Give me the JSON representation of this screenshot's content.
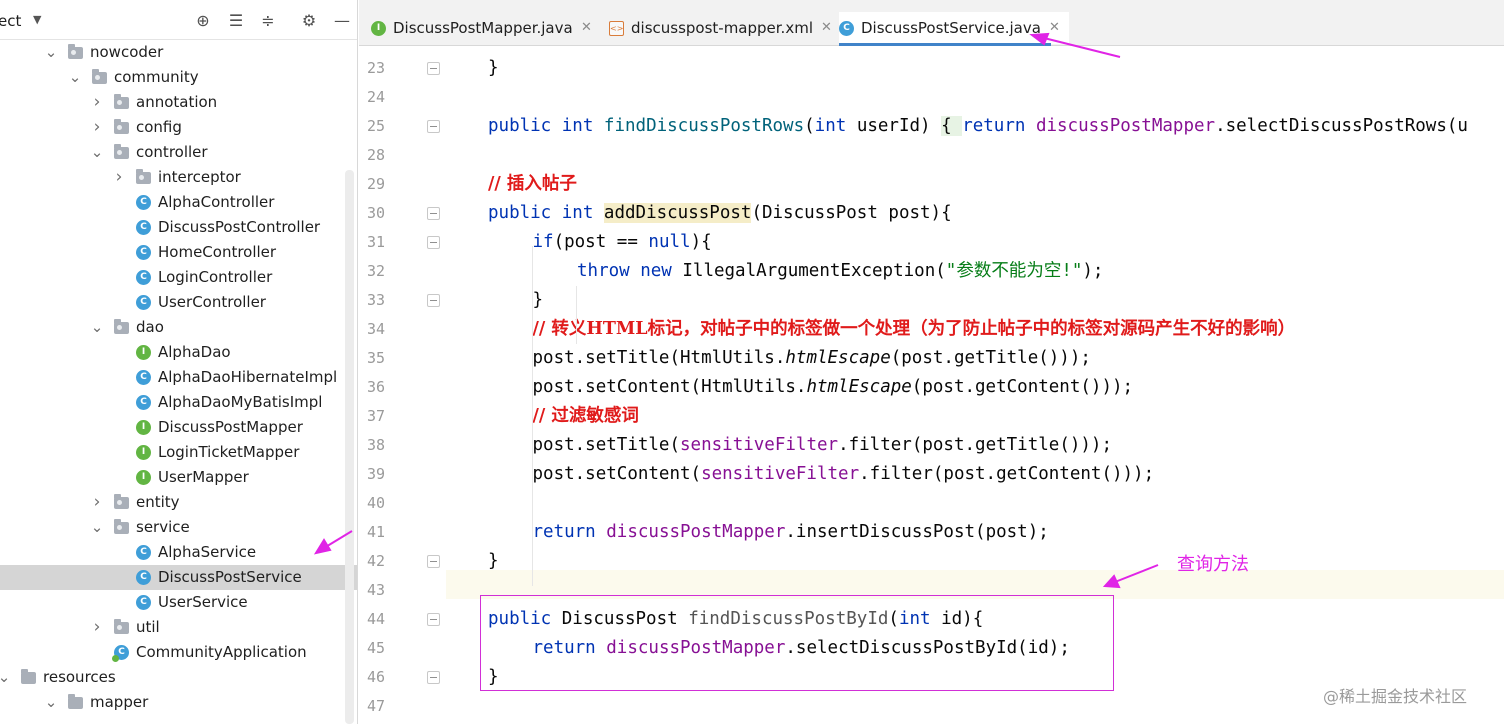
{
  "project": {
    "title": "ect",
    "tree": [
      {
        "label": "nowcoder",
        "type": "package",
        "depth": 1,
        "expanded": true
      },
      {
        "label": "community",
        "type": "package",
        "depth": 2,
        "expanded": true
      },
      {
        "label": "annotation",
        "type": "package",
        "depth": 3,
        "expanded": false
      },
      {
        "label": "config",
        "type": "package",
        "depth": 3,
        "expanded": false
      },
      {
        "label": "controller",
        "type": "package",
        "depth": 3,
        "expanded": true
      },
      {
        "label": "interceptor",
        "type": "package",
        "depth": 4,
        "expanded": false
      },
      {
        "label": "AlphaController",
        "type": "class",
        "depth": 4
      },
      {
        "label": "DiscussPostController",
        "type": "class",
        "depth": 4
      },
      {
        "label": "HomeController",
        "type": "class",
        "depth": 4
      },
      {
        "label": "LoginController",
        "type": "class",
        "depth": 4
      },
      {
        "label": "UserController",
        "type": "class",
        "depth": 4
      },
      {
        "label": "dao",
        "type": "package",
        "depth": 3,
        "expanded": true
      },
      {
        "label": "AlphaDao",
        "type": "interface",
        "depth": 4
      },
      {
        "label": "AlphaDaoHibernateImpl",
        "type": "class",
        "depth": 4
      },
      {
        "label": "AlphaDaoMyBatisImpl",
        "type": "class",
        "depth": 4
      },
      {
        "label": "DiscussPostMapper",
        "type": "interface",
        "depth": 4
      },
      {
        "label": "LoginTicketMapper",
        "type": "interface",
        "depth": 4
      },
      {
        "label": "UserMapper",
        "type": "interface",
        "depth": 4
      },
      {
        "label": "entity",
        "type": "package",
        "depth": 3,
        "expanded": false
      },
      {
        "label": "service",
        "type": "package",
        "depth": 3,
        "expanded": true
      },
      {
        "label": "AlphaService",
        "type": "class",
        "depth": 4
      },
      {
        "label": "DiscussPostService",
        "type": "class",
        "depth": 4,
        "selected": true
      },
      {
        "label": "UserService",
        "type": "class",
        "depth": 4
      },
      {
        "label": "util",
        "type": "package",
        "depth": 3,
        "expanded": false
      },
      {
        "label": "CommunityApplication",
        "type": "app",
        "depth": 3
      },
      {
        "label": "resources",
        "type": "folder",
        "depth": 0,
        "expanded": true
      },
      {
        "label": "mapper",
        "type": "folder",
        "depth": 1,
        "expanded": true
      }
    ]
  },
  "tabs": [
    {
      "label": "DiscussPostMapper.java",
      "icon": "interface-icon",
      "active": false
    },
    {
      "label": "discusspost-mapper.xml",
      "icon": "xml-file-icon",
      "active": false
    },
    {
      "label": "DiscussPostService.java",
      "icon": "class-icon",
      "active": true
    }
  ],
  "editor": {
    "lines": [
      {
        "n": "23",
        "fold": true,
        "indent": 1,
        "tokens": [
          [
            "",
            "}"
          ]
        ]
      },
      {
        "n": "24",
        "tokens": []
      },
      {
        "n": "25",
        "fold": true,
        "indent": 1,
        "tokens": [
          [
            "k",
            "public "
          ],
          [
            "k",
            "int "
          ],
          [
            "f",
            "findDiscussPostRows"
          ],
          [
            "",
            "("
          ],
          [
            "k",
            "int "
          ],
          [
            "",
            "userId) "
          ],
          [
            "brk",
            "{ "
          ],
          [
            "k",
            "return "
          ],
          [
            "fld",
            "discussPostMapper"
          ],
          [
            "",
            ".selectDiscussPostRows(u"
          ]
        ]
      },
      {
        "n": "28",
        "tokens": []
      },
      {
        "n": "29",
        "indent": 1,
        "tokens": [
          [
            "cmt",
            "// 插入帖子"
          ]
        ]
      },
      {
        "n": "30",
        "fold": true,
        "indent": 1,
        "tokens": [
          [
            "k",
            "public "
          ],
          [
            "k",
            "int "
          ],
          [
            "hl",
            "addDiscussPost"
          ],
          [
            "",
            "(DiscussPost post){"
          ]
        ]
      },
      {
        "n": "31",
        "fold": true,
        "indent": 2,
        "tokens": [
          [
            "k",
            "if"
          ],
          [
            "",
            "(post == "
          ],
          [
            "k",
            "null"
          ],
          [
            "",
            "){"
          ]
        ]
      },
      {
        "n": "32",
        "indent": 3,
        "tokens": [
          [
            "k",
            "throw "
          ],
          [
            "k",
            "new "
          ],
          [
            "",
            "IllegalArgumentException("
          ],
          [
            "str",
            "\"参数不能为空!\""
          ],
          [
            "",
            ");"
          ]
        ]
      },
      {
        "n": "33",
        "fold": true,
        "indent": 2,
        "tokens": [
          [
            "",
            "}"
          ]
        ]
      },
      {
        "n": "34",
        "indent": 2,
        "tokens": [
          [
            "cmt",
            "// 转义HTML标记，对帖子中的标签做一个处理（为了防止帖子中的标签对源码产生不好的影响）"
          ]
        ]
      },
      {
        "n": "35",
        "indent": 2,
        "tokens": [
          [
            "",
            "post.setTitle(HtmlUtils."
          ],
          [
            "it",
            "htmlEscape"
          ],
          [
            "",
            "(post.getTitle()));"
          ]
        ]
      },
      {
        "n": "36",
        "indent": 2,
        "tokens": [
          [
            "",
            "post.setContent(HtmlUtils."
          ],
          [
            "it",
            "htmlEscape"
          ],
          [
            "",
            "(post.getContent()));"
          ]
        ]
      },
      {
        "n": "37",
        "indent": 2,
        "tokens": [
          [
            "cmt",
            "// 过滤敏感词"
          ]
        ]
      },
      {
        "n": "38",
        "indent": 2,
        "tokens": [
          [
            "",
            "post.setTitle("
          ],
          [
            "fld",
            "sensitiveFilter"
          ],
          [
            "",
            ".filter(post.getTitle()));"
          ]
        ]
      },
      {
        "n": "39",
        "indent": 2,
        "tokens": [
          [
            "",
            "post.setContent("
          ],
          [
            "fld",
            "sensitiveFilter"
          ],
          [
            "",
            ".filter(post.getContent()));"
          ]
        ]
      },
      {
        "n": "40",
        "tokens": []
      },
      {
        "n": "41",
        "indent": 2,
        "tokens": [
          [
            "k",
            "return "
          ],
          [
            "fld",
            "discussPostMapper"
          ],
          [
            "",
            ".insertDiscussPost(post);"
          ]
        ]
      },
      {
        "n": "42",
        "fold": true,
        "indent": 1,
        "tokens": [
          [
            "",
            "}"
          ]
        ]
      },
      {
        "n": "43",
        "tokens": []
      },
      {
        "n": "44",
        "fold": true,
        "indent": 1,
        "tokens": [
          [
            "k",
            "public "
          ],
          [
            "",
            "DiscussPost "
          ],
          [
            "grey",
            "findDiscussPostById"
          ],
          [
            "",
            "("
          ],
          [
            "k",
            "int "
          ],
          [
            "",
            "id){"
          ]
        ]
      },
      {
        "n": "45",
        "indent": 2,
        "tokens": [
          [
            "k",
            "return "
          ],
          [
            "fld",
            "discussPostMapper"
          ],
          [
            "",
            ".selectDiscussPostById(id);"
          ]
        ]
      },
      {
        "n": "46",
        "fold": true,
        "indent": 1,
        "tokens": [
          [
            "",
            "}"
          ]
        ]
      },
      {
        "n": "47",
        "tokens": []
      }
    ]
  },
  "annotation": {
    "label": "查询方法"
  },
  "watermark": {
    "text": "@稀土掘金技术社区"
  },
  "colors": {
    "keyword": "#0033b3",
    "method": "#00627a",
    "field": "#871094",
    "string": "#067d17",
    "comment": "#e01b1b",
    "annotation": "#e024e6",
    "tab_active_underline": "#4083c9"
  }
}
